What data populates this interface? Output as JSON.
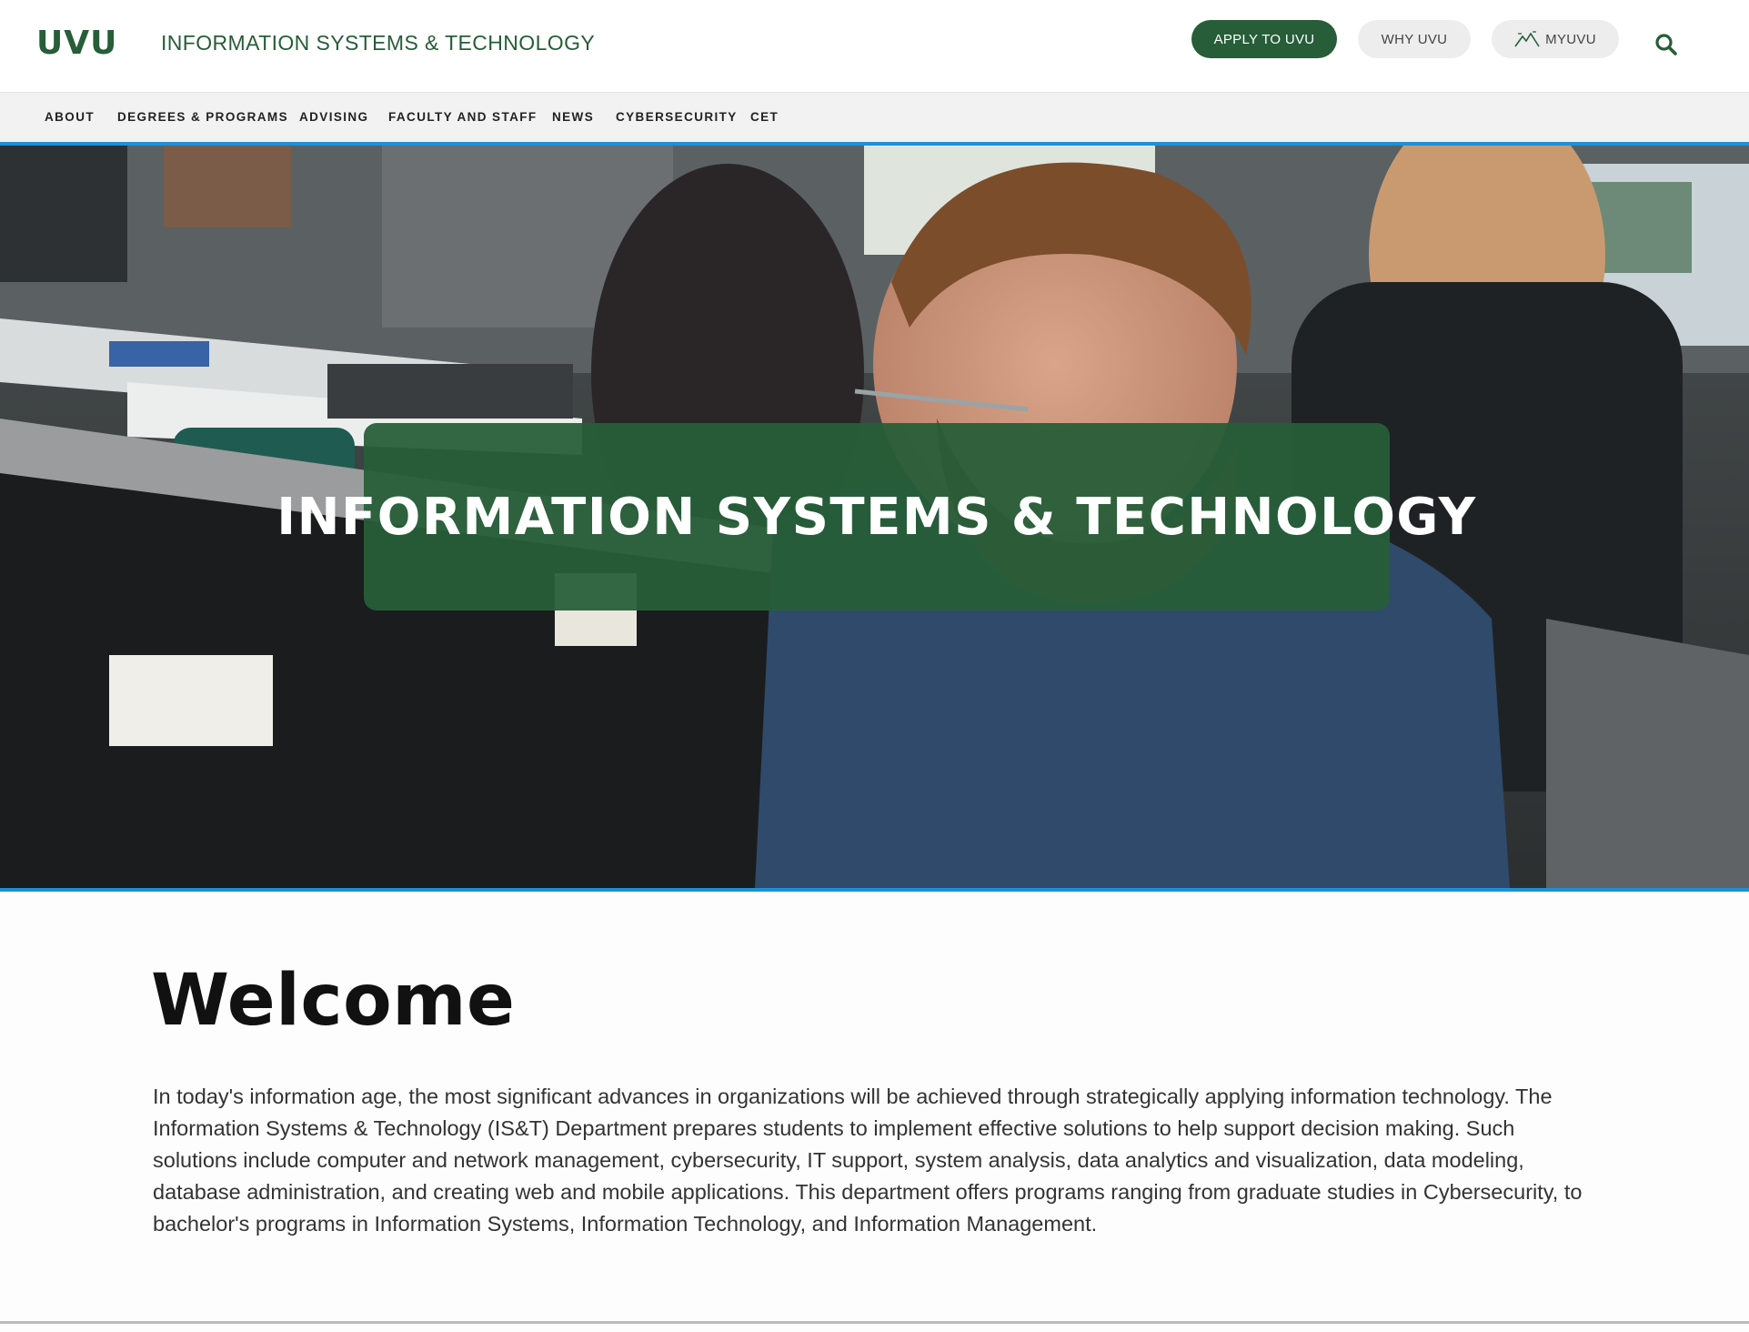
{
  "header": {
    "logo": "UVU",
    "site_title": "INFORMATION SYSTEMS & TECHNOLOGY",
    "buttons": {
      "apply": "APPLY TO UVU",
      "why": "WHY UVU",
      "myuvu": "MYUVU"
    }
  },
  "nav": {
    "items": [
      "ABOUT",
      "DEGREES & PROGRAMS",
      "ADVISING",
      "FACULTY AND STAFF",
      "NEWS",
      "CYBERSECURITY",
      "CET"
    ]
  },
  "hero": {
    "title": "INFORMATION SYSTEMS & TECHNOLOGY"
  },
  "welcome": {
    "heading": "Welcome",
    "body": "In today's information age, the most significant advances in organizations will be achieved through strategically applying information technology. The Information Systems & Technology (IS&T) Department prepares students to implement effective solutions to help support decision making. Such solutions include computer and network management, cybersecurity, IT support, system analysis, data analytics and visualization, data modeling, database administration, and creating web and mobile applications. This department offers programs ranging from graduate studies in Cybersecurity, to bachelor's programs in Information Systems, Information Technology, and Information Management."
  },
  "colors": {
    "brand_green": "#275d38",
    "accent_blue": "#1e90d6"
  },
  "icons": {
    "search": "search-icon",
    "myuvu": "mountain-icon"
  }
}
